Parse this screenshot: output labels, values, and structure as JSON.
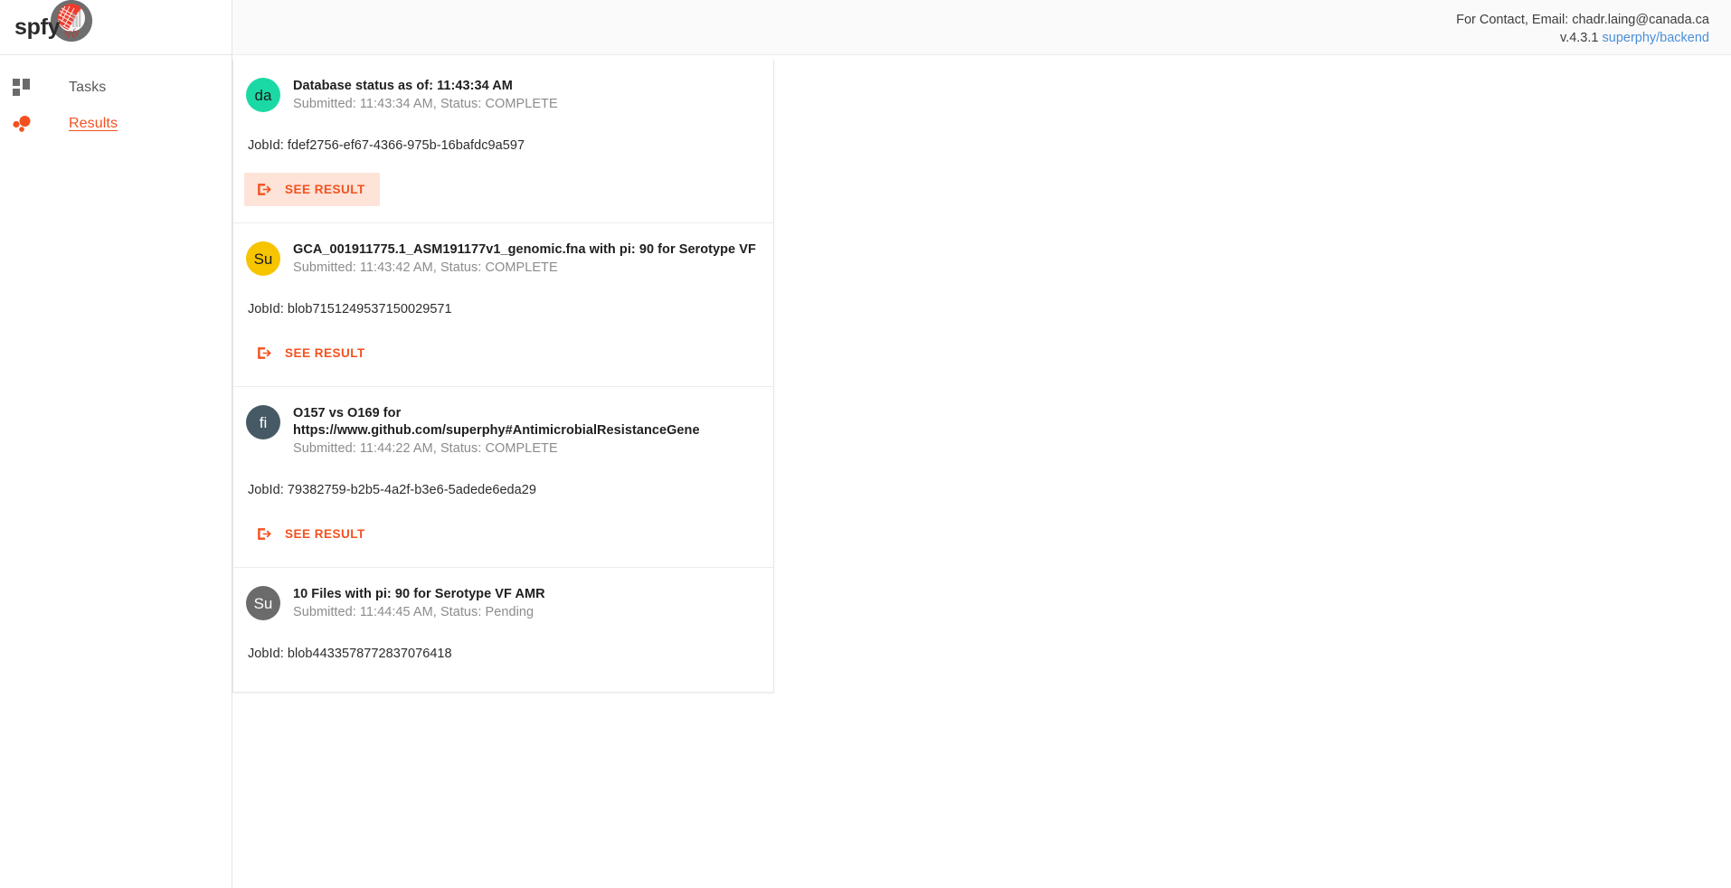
{
  "app": {
    "brand_name": "spfy",
    "brand_logo_icon": "spfy-petri-dish-logo"
  },
  "sidebar": {
    "items": [
      {
        "label": "Tasks",
        "icon": "dashboard-grid-icon",
        "active": false
      },
      {
        "label": "Results",
        "icon": "bubble-chart-icon",
        "active": true
      }
    ]
  },
  "topbar": {
    "contact_text": "For Contact, Email: chadr.laing@canada.ca",
    "version_text": "v.4.3.1",
    "repo_link_text": "superphy/backend"
  },
  "theme": {
    "accent": "#f4511e",
    "accent_soft_bg": "#fde3d8",
    "link_blue": "#4a90d9",
    "avatar_green": "#1bd9a4",
    "avatar_amber": "#f7c400",
    "avatar_slate": "#455a64",
    "avatar_grey": "#6b6b6b"
  },
  "results": {
    "cards": [
      {
        "avatar_initials": "da",
        "avatar_color": "#1bd9a4",
        "avatar_text_dark": true,
        "title": "Database status as of: 11:43:34 AM",
        "subtitle": "Submitted: 11:43:34 AM, Status: COMPLETE",
        "submitted_time": "11:43:34 AM",
        "status": "COMPLETE",
        "jobid_text": "JobId: fdef2756-ef67-4366-975b-16bafdc9a597",
        "jobid": "fdef2756-ef67-4366-975b-16bafdc9a597",
        "action_label": "SEE RESULT",
        "action_icon": "input-arrow-icon",
        "has_action": true,
        "action_highlighted": true
      },
      {
        "avatar_initials": "Su",
        "avatar_color": "#f7c400",
        "avatar_text_dark": true,
        "title": "GCA_001911775.1_ASM191177v1_genomic.fna with pi: 90 for Serotype VF",
        "subtitle": "Submitted: 11:43:42 AM, Status: COMPLETE",
        "submitted_time": "11:43:42 AM",
        "status": "COMPLETE",
        "jobid_text": "JobId: blob7151249537150029571",
        "jobid": "blob7151249537150029571",
        "action_label": "SEE RESULT",
        "action_icon": "input-arrow-icon",
        "has_action": true,
        "action_highlighted": false
      },
      {
        "avatar_initials": "fi",
        "avatar_color": "#455a64",
        "avatar_text_dark": false,
        "title": "O157 vs O169 for https://www.github.com/superphy#AntimicrobialResistanceGene",
        "subtitle": "Submitted: 11:44:22 AM, Status: COMPLETE",
        "submitted_time": "11:44:22 AM",
        "status": "COMPLETE",
        "jobid_text": "JobId: 79382759-b2b5-4a2f-b3e6-5adede6eda29",
        "jobid": "79382759-b2b5-4a2f-b3e6-5adede6eda29",
        "action_label": "SEE RESULT",
        "action_icon": "input-arrow-icon",
        "has_action": true,
        "action_highlighted": false
      },
      {
        "avatar_initials": "Su",
        "avatar_color": "#6b6b6b",
        "avatar_text_dark": false,
        "title": "10 Files with pi: 90 for Serotype VF AMR",
        "subtitle": "Submitted: 11:44:45 AM, Status: Pending",
        "submitted_time": "11:44:45 AM",
        "status": "Pending",
        "jobid_text": "JobId: blob4433578772837076418",
        "jobid": "blob4433578772837076418",
        "action_label": "",
        "action_icon": "",
        "has_action": false,
        "action_highlighted": false
      }
    ]
  }
}
